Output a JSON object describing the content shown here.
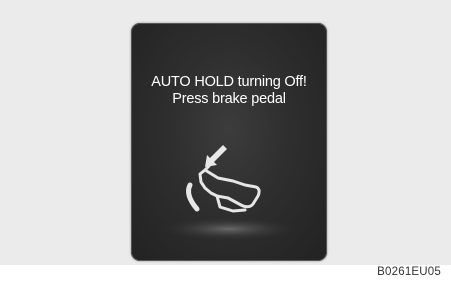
{
  "display": {
    "line1": "AUTO HOLD turning Off!",
    "line2": "Press brake pedal",
    "icon": "foot-pressing-brake-pedal-icon"
  },
  "caption": "B0261EU05",
  "colors": {
    "background": "#ebebeb",
    "screen": "#2e2e2e",
    "text": "#ffffff"
  }
}
